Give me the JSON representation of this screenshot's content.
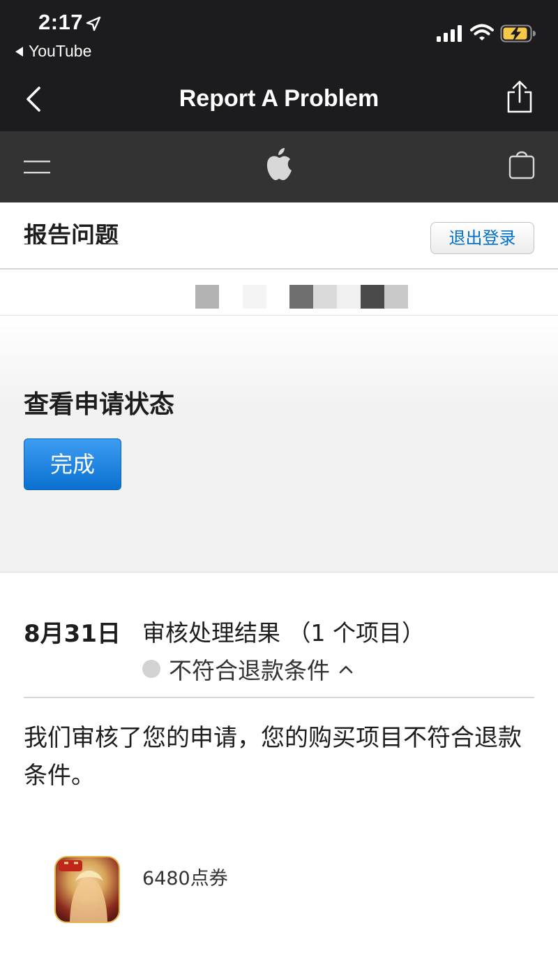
{
  "status_bar": {
    "time": "2:17",
    "back_app": "YouTube",
    "icons": [
      "location-arrow-icon",
      "signal-icon",
      "wifi-icon",
      "battery-charging-icon"
    ],
    "battery_color": "#f7c948"
  },
  "nav": {
    "title": "Report A Problem",
    "icons": [
      "chevron-left-icon",
      "share-icon"
    ]
  },
  "global_nav": {
    "icons": [
      "menu-icon",
      "apple-logo-icon",
      "bag-icon"
    ]
  },
  "page_header": {
    "title": "报告问题",
    "sign_out": "退出登录"
  },
  "status_section": {
    "title": "查看申请状态",
    "done_button": "完成",
    "accent": "#0a70d0"
  },
  "result": {
    "date": "8月31日",
    "heading": "审核处理结果 （1 个项目）",
    "status": "不符合退款条件",
    "message": "我们审核了您的申请，您的购买项目不符合退款条件。"
  },
  "item": {
    "name": "6480点券",
    "icon": "game-app-icon"
  }
}
